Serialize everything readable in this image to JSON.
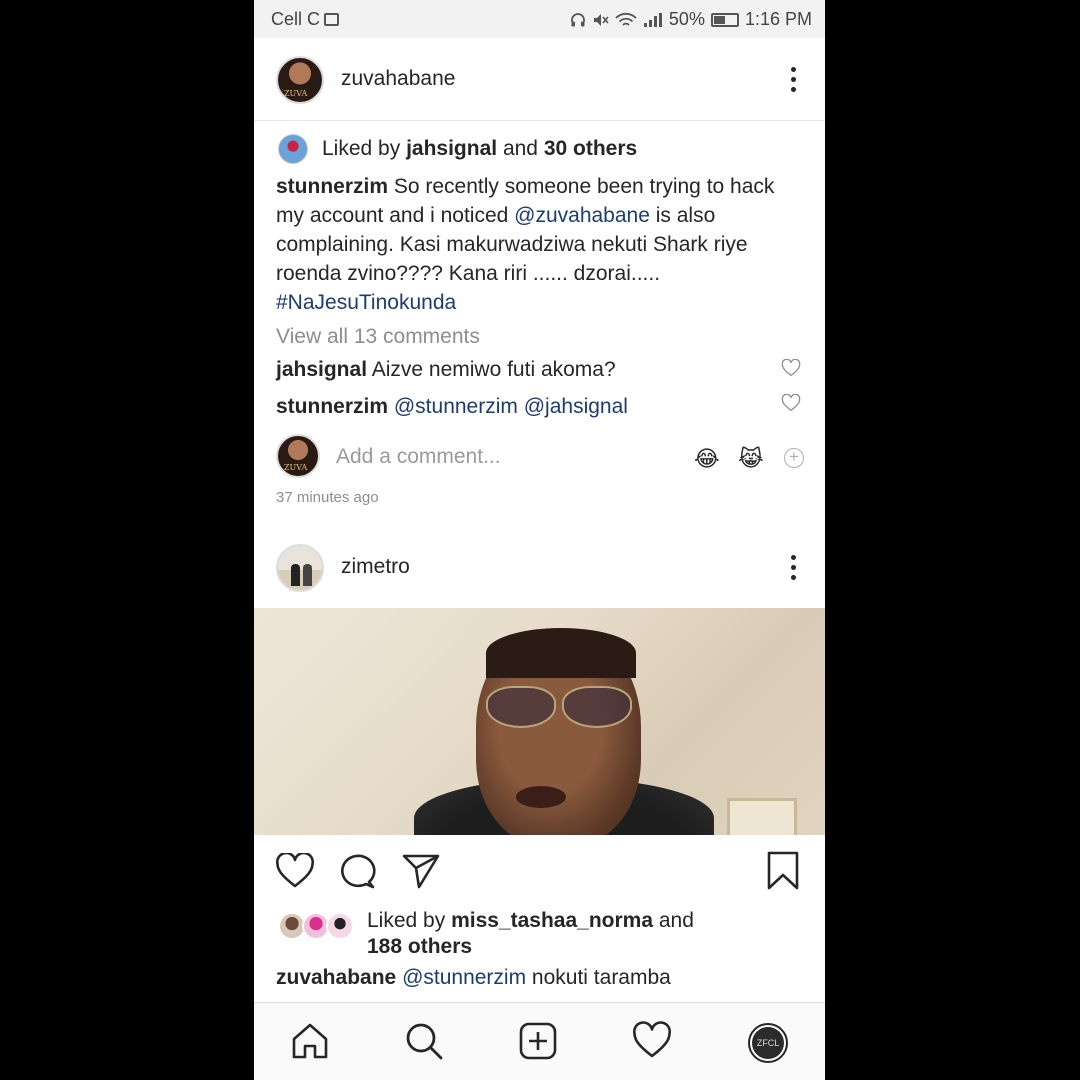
{
  "status_bar": {
    "carrier": "Cell C",
    "battery": "50%",
    "time": "1:16 PM"
  },
  "post1": {
    "username": "zuvahabane",
    "avatar_logo": "ZUVA",
    "liked_by_prefix": "Liked by",
    "liked_by_user": "jahsignal",
    "liked_by_and": "and",
    "liked_by_others": "30 others",
    "caption": {
      "author": "stunnerzim",
      "text_before": " So recently someone been trying to hack my account and i noticed ",
      "mention": "@zuvahabane",
      "text_after": " is also complaining. Kasi makurwadziwa nekuti Shark riye roenda zvino???? Kana riri ...... dzorai.....",
      "hashtag": "#NaJesuTinokunda"
    },
    "view_all_comments": "View all 13 comments",
    "comments": [
      {
        "author": "jahsignal",
        "text": "Aizve nemiwo futi akoma?"
      },
      {
        "author": "stunnerzim",
        "mentions": [
          "@stunnerzim",
          "@jahsignal"
        ]
      }
    ],
    "add_comment_placeholder": "Add a comment...",
    "emojis": [
      "😂",
      "😹"
    ],
    "timestamp": "37 minutes ago"
  },
  "post2": {
    "username": "zimetro",
    "liked_by_prefix": "Liked by",
    "liked_by_user": "miss_tashaa_norma",
    "liked_by_and": "and",
    "liked_by_others": "188 others",
    "caption": {
      "author": "zuvahabane",
      "mention": "@stunnerzim",
      "text": " nokuti taramba"
    }
  },
  "bottom_nav": {
    "items": [
      "home-icon",
      "search-icon",
      "add-post-icon",
      "activity-heart-icon",
      "profile-avatar"
    ],
    "profile_initials": "ZFCL"
  },
  "colors": {
    "mention": "#1c3d6d",
    "muted": "#8e8e8e",
    "text": "#262626"
  }
}
